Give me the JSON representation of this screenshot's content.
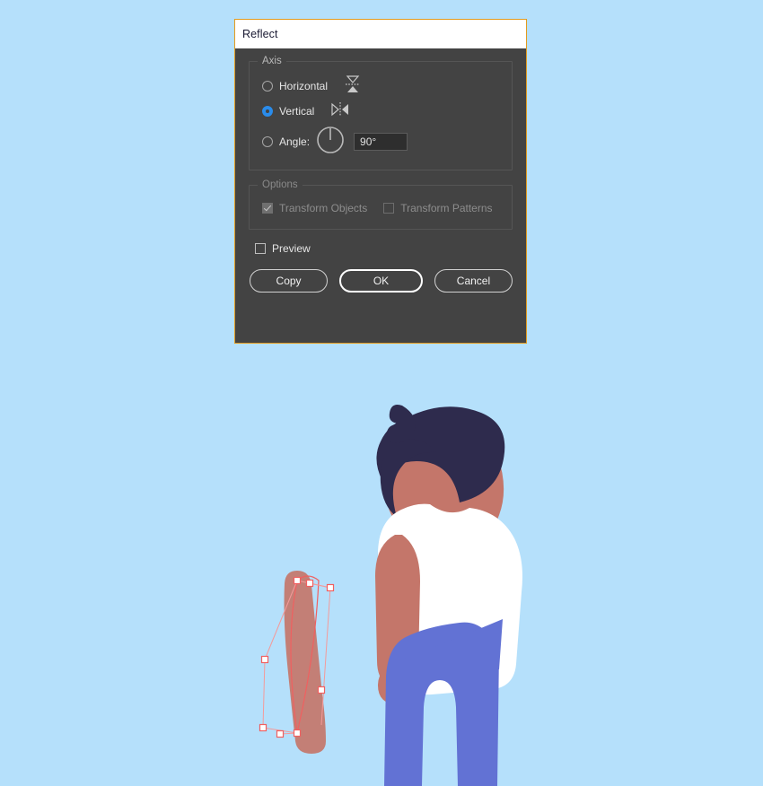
{
  "canvas": {
    "background_color": "#b5e0fb",
    "artwork": {
      "name": "person-with-stick-illustration",
      "colors": {
        "skin": "#c4766a",
        "skin_shadow": "#a95f58",
        "hair": "#2e2b4d",
        "shirt": "#ffffff",
        "pants": "#6272d4",
        "stick": "#c4766a"
      },
      "selection": {
        "stroke_color": "#f06060",
        "anchor_fill": "#ffffff",
        "handle_color": "#f49a9a",
        "anchor_count": 7
      }
    }
  },
  "dialog": {
    "name": "reflect-dialog",
    "title": "Reflect",
    "border_color": "#e39a1d",
    "background_color": "#434343",
    "titlebar_background": "#ffffff",
    "axis_group": {
      "legend": "Axis",
      "options": [
        {
          "label": "Horizontal",
          "selected": false,
          "icon": "reflect-horizontal-icon"
        },
        {
          "label": "Vertical",
          "selected": true,
          "icon": "reflect-vertical-icon"
        },
        {
          "label": "Angle:",
          "selected": false,
          "icon": "angle-dial-icon"
        }
      ],
      "angle_value": "90°",
      "selected_accent_color": "#2a8ceb"
    },
    "options_group": {
      "legend": "Options",
      "disabled": true,
      "checkboxes": [
        {
          "label": "Transform Objects",
          "checked": true,
          "disabled": true
        },
        {
          "label": "Transform Patterns",
          "checked": false,
          "disabled": true
        }
      ]
    },
    "preview": {
      "label": "Preview",
      "checked": false
    },
    "buttons": [
      {
        "label": "Copy",
        "default": false
      },
      {
        "label": "OK",
        "default": true
      },
      {
        "label": "Cancel",
        "default": false
      }
    ]
  }
}
